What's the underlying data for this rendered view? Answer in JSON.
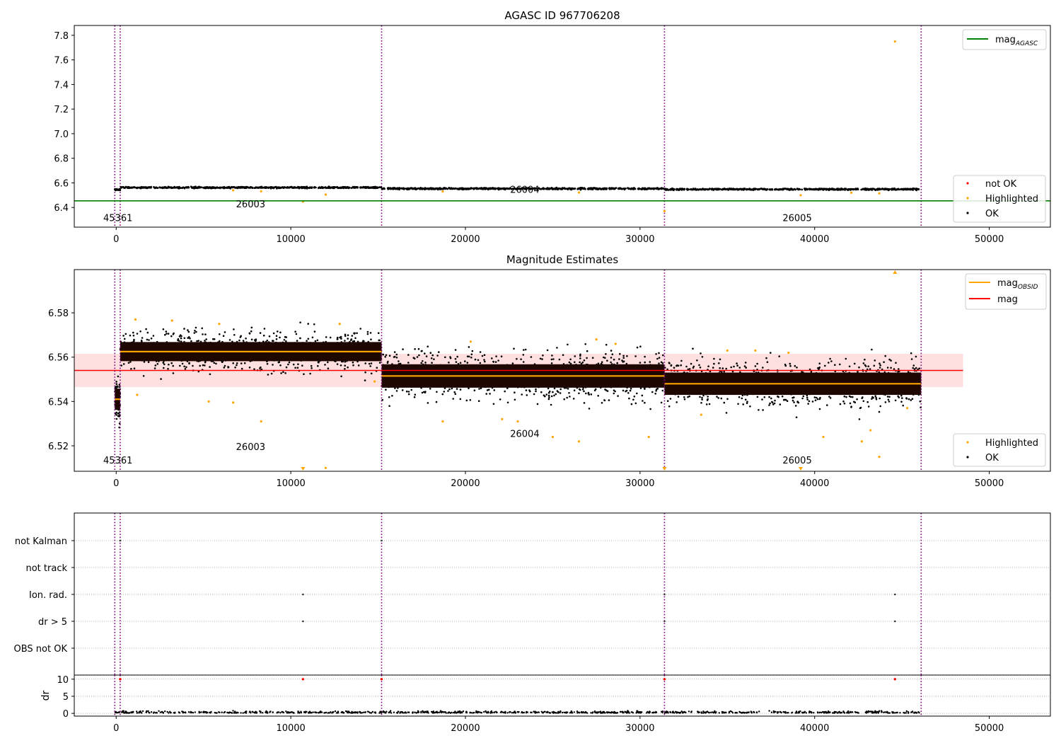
{
  "chart_data": [
    {
      "type": "scatter",
      "title": "AGASC ID 967706208",
      "xlim": [
        -2400,
        53500
      ],
      "ylim": [
        6.24,
        7.88
      ],
      "xticks": [
        0,
        10000,
        20000,
        30000,
        40000,
        50000
      ],
      "yticks": [
        6.4,
        6.6,
        6.8,
        7.0,
        7.2,
        7.4,
        7.6,
        7.8
      ],
      "ytick_labels": [
        "6.4",
        "6.6",
        "6.8",
        "7.0",
        "7.2",
        "7.4",
        "7.6",
        "7.8"
      ],
      "obsid_boundaries": [
        -80,
        230,
        15200,
        31400,
        46100
      ],
      "obsid_labels": [
        {
          "text": "45361",
          "x": 100,
          "y": 6.29
        },
        {
          "text": "26003",
          "x": 7700,
          "y": 6.4
        },
        {
          "text": "26004",
          "x": 23400,
          "y": 6.52
        },
        {
          "text": "26005",
          "x": 39000,
          "y": 6.29
        }
      ],
      "lines": [
        {
          "name": "mag_AGASC",
          "y": 6.454,
          "color": "#008000"
        }
      ],
      "series_ok": {
        "name": "OK",
        "color": "#000000",
        "segments": [
          {
            "x0": -80,
            "x1": 230,
            "y": 6.545
          },
          {
            "x0": 230,
            "x1": 15200,
            "y": 6.562
          },
          {
            "x0": 15200,
            "x1": 31400,
            "y": 6.553
          },
          {
            "x0": 31400,
            "x1": 46100,
            "y": 6.548
          }
        ]
      },
      "series_highlighted": {
        "name": "Highlighted",
        "color": "#ffa500",
        "points": [
          [
            44600,
            7.75
          ],
          [
            10700,
            6.448
          ],
          [
            12000,
            6.505
          ],
          [
            8300,
            6.531
          ],
          [
            31400,
            6.37
          ],
          [
            39200,
            6.5
          ],
          [
            42100,
            6.52
          ],
          [
            43700,
            6.515
          ],
          [
            26500,
            6.522
          ],
          [
            6700,
            6.54
          ],
          [
            18700,
            6.53
          ]
        ]
      },
      "legend_upper": [
        {
          "label": "mag",
          "sub": "AGASC",
          "kind": "line",
          "color": "#008000"
        }
      ],
      "legend_lower": [
        {
          "label": "not OK",
          "kind": "dot",
          "color": "#ff0000"
        },
        {
          "label": "Highlighted",
          "kind": "dot",
          "color": "#ffa500"
        },
        {
          "label": "OK",
          "kind": "dot",
          "color": "#000000"
        }
      ]
    },
    {
      "type": "scatter",
      "title": "Magnitude Estimates",
      "xlim": [
        -2400,
        53500
      ],
      "ylim": [
        6.5085,
        6.5995
      ],
      "xticks": [
        0,
        10000,
        20000,
        30000,
        40000,
        50000
      ],
      "yticks": [
        6.52,
        6.54,
        6.56,
        6.58
      ],
      "ytick_labels": [
        "6.52",
        "6.54",
        "6.56",
        "6.58"
      ],
      "obsid_boundaries": [
        -80,
        230,
        15200,
        31400,
        46100
      ],
      "obsid_labels": [
        {
          "text": "45361",
          "x": 100,
          "y": 6.512
        },
        {
          "text": "26003",
          "x": 7700,
          "y": 6.518
        },
        {
          "text": "26004",
          "x": 23400,
          "y": 6.524
        },
        {
          "text": "26005",
          "x": 39000,
          "y": 6.512
        }
      ],
      "mag": {
        "name": "mag",
        "y": 6.554,
        "band": [
          6.5465,
          6.5615
        ],
        "x0": -2400,
        "x1": 48500,
        "color": "#ff0000"
      },
      "mag_obsid": {
        "name": "mag_OBSID",
        "color": "#ffa500",
        "segments": [
          {
            "x0": -80,
            "x1": 230,
            "y": 6.541,
            "ymin": 6.531,
            "ymax": 6.551
          },
          {
            "x0": 230,
            "x1": 15200,
            "y": 6.5625,
            "ymin": 6.555,
            "ymax": 6.573
          },
          {
            "x0": 15200,
            "x1": 31400,
            "y": 6.5515,
            "ymin": 6.541,
            "ymax": 6.563
          },
          {
            "x0": 31400,
            "x1": 46100,
            "y": 6.548,
            "ymin": 6.539,
            "ymax": 6.56
          }
        ]
      },
      "series_highlighted": {
        "name": "Highlighted",
        "color": "#ffa500",
        "points": [
          [
            1100,
            6.577
          ],
          [
            1200,
            6.543
          ],
          [
            3200,
            6.5765
          ],
          [
            5300,
            6.54
          ],
          [
            6700,
            6.5395
          ],
          [
            8300,
            6.531
          ],
          [
            10700,
            6.509
          ],
          [
            12000,
            6.51
          ],
          [
            14800,
            6.549
          ],
          [
            18700,
            6.531
          ],
          [
            20300,
            6.567
          ],
          [
            22100,
            6.532
          ],
          [
            23000,
            6.531
          ],
          [
            25000,
            6.524
          ],
          [
            26500,
            6.522
          ],
          [
            27500,
            6.568
          ],
          [
            30500,
            6.524
          ],
          [
            31400,
            6.509
          ],
          [
            35000,
            6.563
          ],
          [
            36600,
            6.563
          ],
          [
            38500,
            6.562
          ],
          [
            39200,
            6.509
          ],
          [
            40500,
            6.524
          ],
          [
            42700,
            6.522
          ],
          [
            43200,
            6.527
          ],
          [
            43700,
            6.515
          ],
          [
            44600,
            6.599
          ],
          [
            45300,
            6.537
          ],
          [
            5900,
            6.575
          ],
          [
            12800,
            6.575
          ],
          [
            28600,
            6.566
          ],
          [
            33500,
            6.534
          ]
        ]
      },
      "legend_upper": [
        {
          "label": "mag",
          "sub": "OBSID",
          "kind": "line",
          "color": "#ffa500"
        },
        {
          "label": "mag",
          "kind": "line",
          "color": "#ff0000"
        }
      ],
      "legend_lower": [
        {
          "label": "Highlighted",
          "kind": "dot",
          "color": "#ffa500"
        },
        {
          "label": "OK",
          "kind": "dot",
          "color": "#000000"
        }
      ]
    },
    {
      "type": "scatter",
      "title": "",
      "xlim": [
        -2400,
        53500
      ],
      "xticks": [
        0,
        10000,
        20000,
        30000,
        40000,
        50000
      ],
      "obsid_boundaries": [
        -80,
        230,
        15200,
        31400,
        46100
      ],
      "flag_rows": [
        "not Kalman",
        "not track",
        "Ion. rad.",
        "dr > 5",
        "OBS not OK"
      ],
      "flag_points": [
        {
          "row": "not Kalman",
          "x": [
            230,
            15200
          ]
        },
        {
          "row": "Ion. rad.",
          "x": [
            10700,
            31400,
            44600
          ]
        },
        {
          "row": "dr > 5",
          "x": [
            10700,
            31400,
            44600
          ]
        }
      ]
    },
    {
      "type": "scatter",
      "title": "",
      "xlim": [
        -2400,
        53500
      ],
      "ylim": [
        -0.8,
        11.2
      ],
      "ylabel": "dr",
      "xticks": [
        0,
        10000,
        20000,
        30000,
        40000,
        50000
      ],
      "yticks": [
        0,
        5,
        10
      ],
      "ytick_labels": [
        "0",
        "5",
        "10"
      ],
      "obsid_boundaries": [
        -80,
        230,
        15200,
        31400,
        46100
      ],
      "series_ok": {
        "name": "OK",
        "color": "#000000",
        "x0": -80,
        "x1": 46100,
        "y": 0.1
      },
      "series_not_ok": {
        "name": "not OK",
        "color": "#ff0000",
        "points": [
          [
            230,
            10
          ],
          [
            10700,
            10
          ],
          [
            15200,
            10
          ],
          [
            31400,
            10
          ],
          [
            44600,
            10
          ]
        ]
      }
    }
  ]
}
